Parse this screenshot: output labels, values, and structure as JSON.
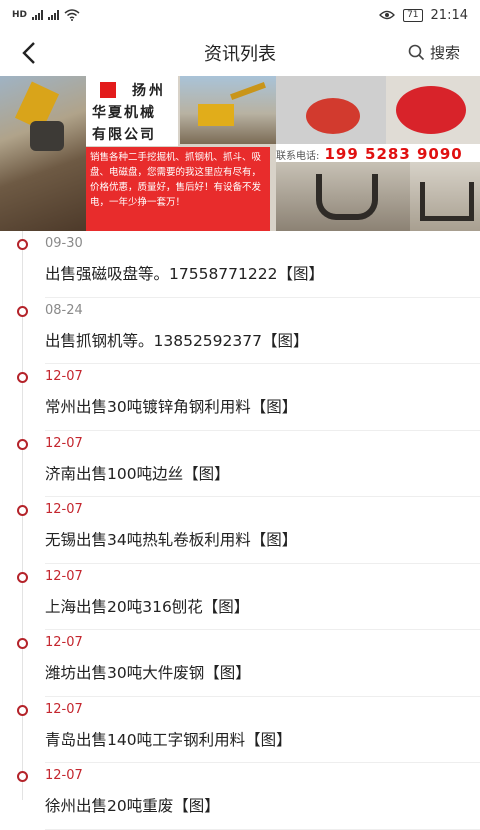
{
  "status": {
    "left": "HD",
    "time": "21:14",
    "battery": "71"
  },
  "header": {
    "title": "资讯列表",
    "search_label": "搜索"
  },
  "banner": {
    "company_line1": "扬州",
    "company_line2": "华夏机械",
    "company_line3": "有限公司",
    "promo_text": "销售各种二手挖掘机、抓钢机、抓斗、吸盘、电磁盘，您需要的我这里应有尽有，价格优惠，质量好，售后好！有设备不发电，一年少挣一套万！",
    "contact_label": "联系电话:",
    "contact_phone": "199 5283 9090",
    "colors": {
      "promo_bg": "#e82c2c",
      "phone": "#e01010"
    }
  },
  "news": [
    {
      "date": "09-30",
      "title": "出售强磁吸盘等。17558771222【图】",
      "recent": false
    },
    {
      "date": "08-24",
      "title": "出售抓钢机等。13852592377【图】",
      "recent": false
    },
    {
      "date": "12-07",
      "title": "常州出售30吨镀锌角钢利用料【图】",
      "recent": true
    },
    {
      "date": "12-07",
      "title": "济南出售100吨边丝【图】",
      "recent": true
    },
    {
      "date": "12-07",
      "title": "无锡出售34吨热轧卷板利用料【图】",
      "recent": true
    },
    {
      "date": "12-07",
      "title": "上海出售20吨316刨花【图】",
      "recent": true
    },
    {
      "date": "12-07",
      "title": "潍坊出售30吨大件废钢【图】",
      "recent": true
    },
    {
      "date": "12-07",
      "title": "青岛出售140吨工字钢利用料【图】",
      "recent": true
    },
    {
      "date": "12-07",
      "title": "徐州出售20吨重废【图】",
      "recent": true
    }
  ],
  "theme": {
    "accent": "#c4262e",
    "date_gray": "#8a8a8a"
  }
}
